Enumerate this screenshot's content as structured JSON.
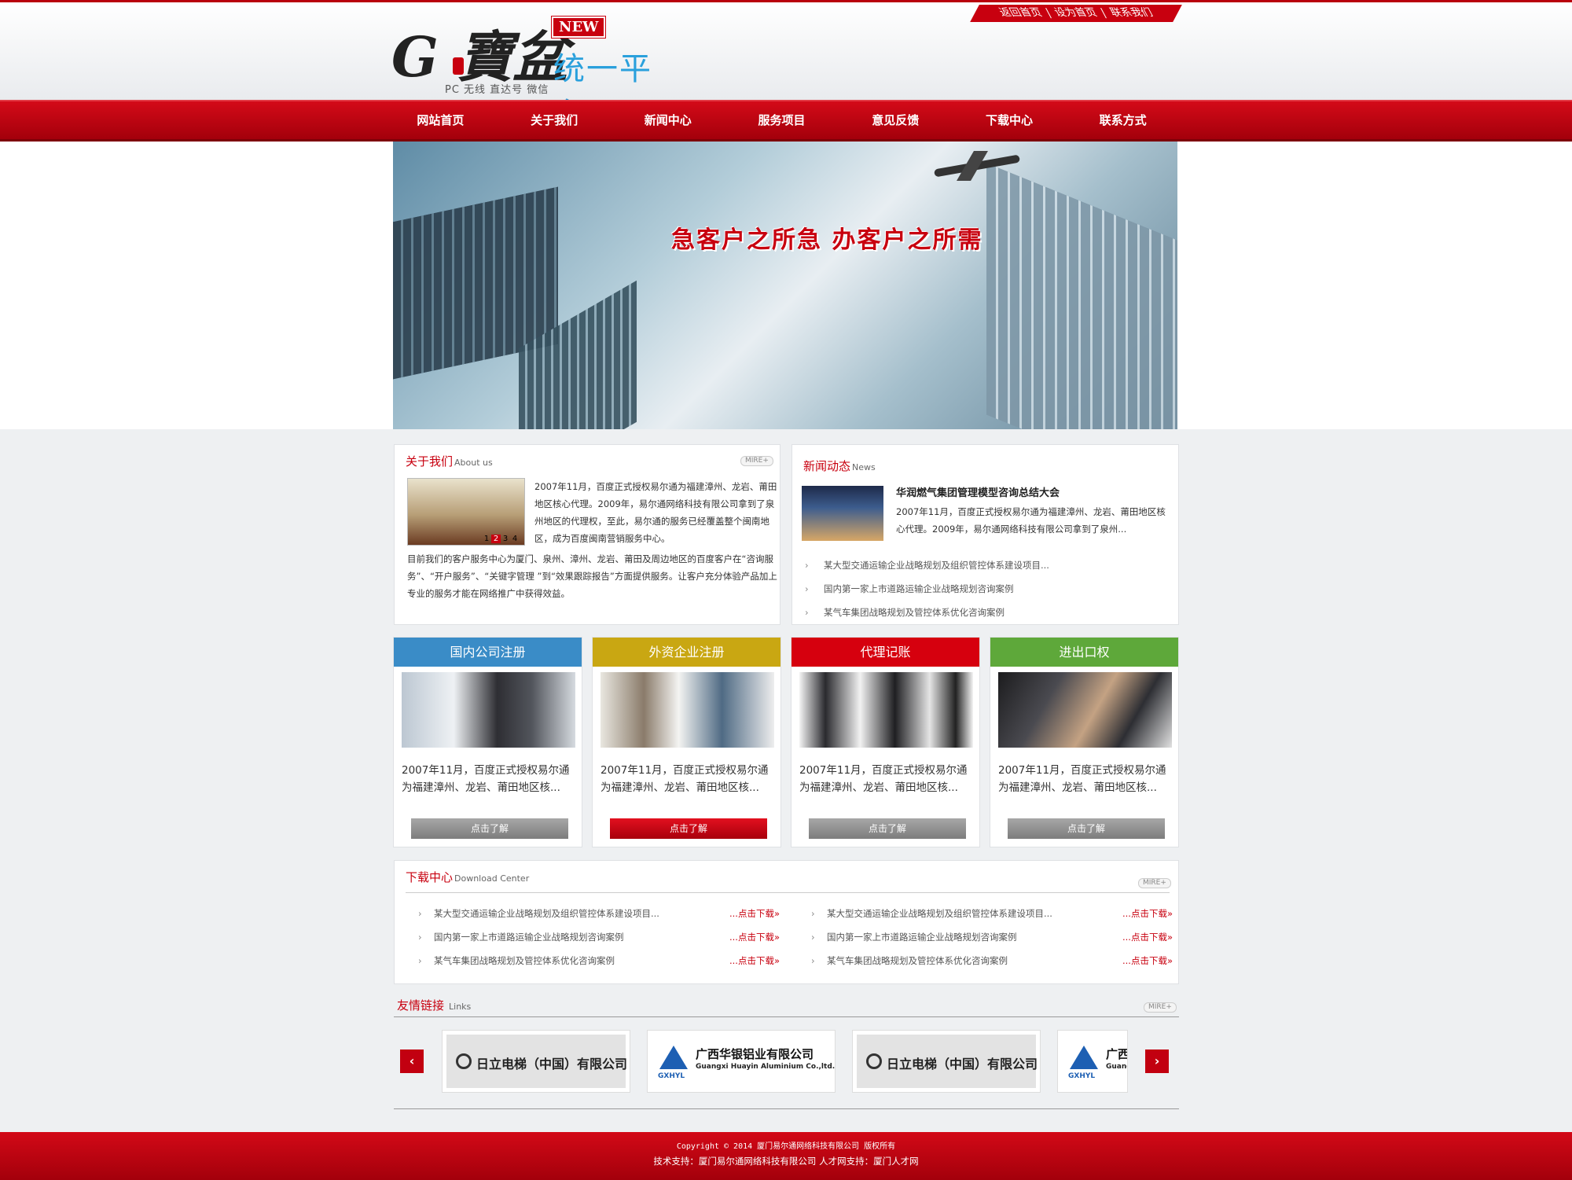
{
  "top_links": [
    "返回首页",
    "设为首页",
    "联系我们"
  ],
  "logo": {
    "badge": "NEW",
    "title": "统一平台",
    "tagline": "PC 无线 直达号 微信",
    "mark_text": "G 寶盆"
  },
  "nav": [
    "网站首页",
    "关于我们",
    "新闻中心",
    "服务项目",
    "意见反馈",
    "下载中心",
    "联系方式"
  ],
  "banner": {
    "slogan": "急客户之所急  办客户之所需"
  },
  "about": {
    "title": "关于我们",
    "title_en": "About us",
    "more": "MIRE+",
    "slider_pages": [
      "1",
      "2",
      "3",
      "4"
    ],
    "text1": "2007年11月，百度正式授权易尔通为福建漳州、龙岩、莆田地区核心代理。2009年，易尔通网络科技有限公司拿到了泉州地区的代理权，至此，易尔通的服务已经覆盖整个闽南地区，成为百度闽南营销服务中心。",
    "text2": "目前我们的客户服务中心为厦门、泉州、漳州、龙岩、莆田及周边地区的百度客户在“咨询服务”、“开户服务”、“关键字管理 ”到“效果跟踪报告”方面提供服务。让客户充分体验产品加上专业的服务才能在网络推广中获得效益。"
  },
  "news": {
    "title": "新闻动态",
    "title_en": "News",
    "headline": "华润燃气集团管理模型咨询总结大会",
    "desc": "2007年11月，百度正式授权易尔通为福建漳州、龙岩、莆田地区核心代理。2009年，易尔通网络科技有限公司拿到了泉州...",
    "items": [
      "某大型交通运输企业战略规划及组织管控体系建设项目...",
      "国内第一家上市道路运输企业战略规划咨询案例",
      "某气车集团战略规划及管控体系优化咨询案例"
    ]
  },
  "services": [
    {
      "title": "国内公司注册",
      "color": "#3a8cc7",
      "text": "2007年11月，百度正式授权易尔通为福建漳州、龙岩、莆田地区核...",
      "button": "点击了解"
    },
    {
      "title": "外资企业注册",
      "color": "#c9a712",
      "text": "2007年11月，百度正式授权易尔通为福建漳州、龙岩、莆田地区核...",
      "button": "点击了解"
    },
    {
      "title": "代理记账",
      "color": "#d6000e",
      "text": "2007年11月，百度正式授权易尔通为福建漳州、龙岩、莆田地区核...",
      "button": "点击了解"
    },
    {
      "title": "进出口权",
      "color": "#5ea83a",
      "text": "2007年11月，百度正式授权易尔通为福建漳州、龙岩、莆田地区核...",
      "button": "点击了解"
    }
  ],
  "download": {
    "title": "下载中心",
    "title_en": "Download Center",
    "more": "MIRE+",
    "action": "...点击下载»",
    "left": [
      "某大型交通运输企业战略规划及组织管控体系建设项目...",
      "国内第一家上市道路运输企业战略规划咨询案例",
      "某气车集团战略规划及管控体系优化咨询案例"
    ],
    "right": [
      "某大型交通运输企业战略规划及组织管控体系建设项目...",
      "国内第一家上市道路运输企业战略规划咨询案例",
      "某气车集团战略规划及管控体系优化咨询案例"
    ]
  },
  "links": {
    "title": "友情链接",
    "title_en": "Links",
    "more": "MIRE+",
    "prev": "‹",
    "next": "›",
    "partners": [
      {
        "name": "日立电梯（中国）有限公司"
      },
      {
        "name": "广西华银铝业有限公司",
        "name_en": "Guangxi Huayin Aluminium Co.,ltd.",
        "mark": "GXHYL"
      },
      {
        "name": "日立电梯（中国）有限公司"
      },
      {
        "name": "广西",
        "name_en": "Guang",
        "mark": "GXHYL"
      }
    ]
  },
  "footer": {
    "line1": "Copyright © 2014  厦门易尔通网络科技有限公司  版权所有",
    "line2": "技术支持：厦门易尔通网络科技有限公司 人才网支持：厦门人才网"
  }
}
